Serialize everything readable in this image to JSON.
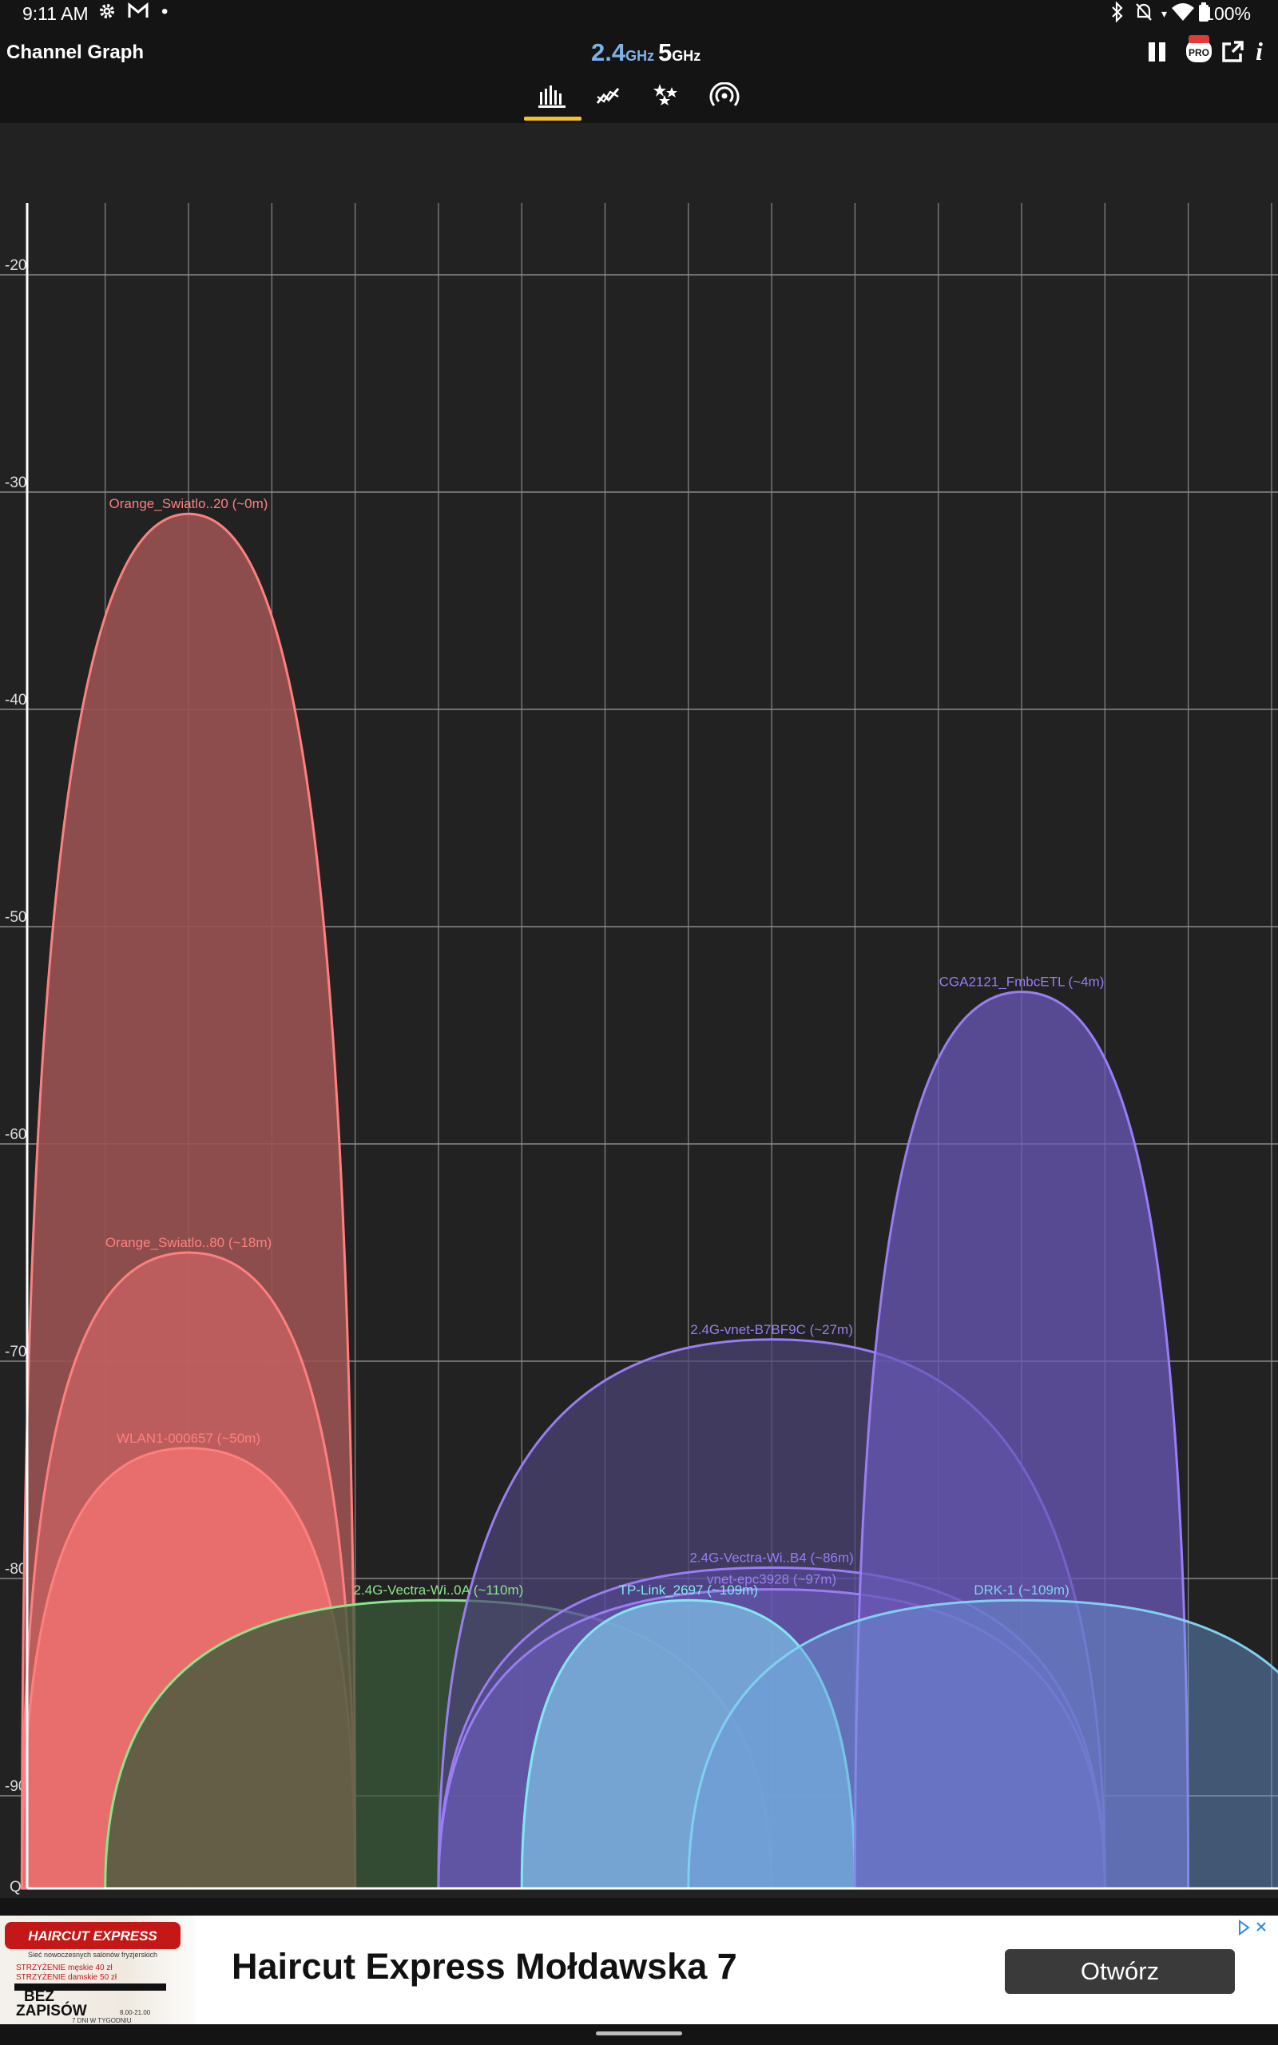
{
  "status_bar": {
    "time": "9:11 AM",
    "left_icons": [
      "gear-icon",
      "gmail-icon",
      "dot-icon"
    ],
    "right_icons": [
      "bluetooth-icon",
      "mute-icon",
      "wifi-icon",
      "battery-icon"
    ],
    "battery": "100%"
  },
  "app_bar": {
    "title": "Channel Graph",
    "band_24": {
      "num": "2.4",
      "unit": "GHz"
    },
    "band_5": {
      "num": "5",
      "unit": "GHz"
    },
    "actions": [
      "pause-icon",
      "pro-badge-icon",
      "export-icon",
      "info-icon"
    ],
    "tabs": [
      {
        "name": "channel-graph",
        "icon": "bar-chart-icon",
        "selected": true
      },
      {
        "name": "time-graph",
        "icon": "line-chart-icon",
        "selected": false
      },
      {
        "name": "channel-rating",
        "icon": "stars-icon",
        "selected": false
      },
      {
        "name": "access-points",
        "icon": "signal-icon",
        "selected": false
      }
    ],
    "accent_color": "#f6c02a"
  },
  "chart_data": {
    "type": "area",
    "ylabel": "",
    "xlabel": "",
    "ylim": [
      -100,
      -20
    ],
    "y_ticks": [
      "-20",
      "-30",
      "-40",
      "-50",
      "-60",
      "-70",
      "-80",
      "-90",
      "Q"
    ],
    "grid": true,
    "x_range": [
      -1,
      15
    ],
    "series": [
      {
        "name": "Orange_Swiatlo..20 (~0m)",
        "channel": 1,
        "width": 4,
        "peak": -31,
        "color": "#ff7f7f",
        "fill": "#9a5252",
        "fill_opacity": 0.9
      },
      {
        "name": "Orange_Swiatlo..80 (~18m)",
        "channel": 1,
        "width": 4,
        "peak": -65,
        "color": "#ff7f7f",
        "fill": "#c86262",
        "fill_opacity": 0.8
      },
      {
        "name": "WLAN1-000657 (~50m)",
        "channel": 1,
        "width": 4,
        "peak": -74,
        "color": "#ff7f7f",
        "fill": "#f07070",
        "fill_opacity": 0.85
      },
      {
        "name": "2.4G-Vectra-Wi..0A (~110m)",
        "channel": 4,
        "width": 8,
        "peak": -81,
        "color": "#8ae68a",
        "fill": "#3a5a3a",
        "fill_opacity": 0.75
      },
      {
        "name": "2.4G-vnet-B7BF9C (~27m)",
        "channel": 8,
        "width": 8,
        "peak": -69,
        "color": "#9a7cf5",
        "fill": "#4c4478",
        "fill_opacity": 0.7
      },
      {
        "name": "2.4G-Vectra-Wi..B4 (~86m)",
        "channel": 8,
        "width": 8,
        "peak": -79.5,
        "color": "#9a7cf5",
        "fill": "#6a58c8",
        "fill_opacity": 0.35
      },
      {
        "name": "vnet-epc3928 (~97m)",
        "channel": 8,
        "width": 8,
        "peak": -80.5,
        "color": "#9a7cf5",
        "fill": "#7a66d8",
        "fill_opacity": 0.35
      },
      {
        "name": "TP-Link_2697 (~109m)",
        "channel": 7,
        "width": 4,
        "peak": -81,
        "color": "#7fe8f0",
        "fill": "#7ab8e0",
        "fill_opacity": 0.8
      },
      {
        "name": "CGA2121_FmbcETL (~4m)",
        "channel": 11,
        "width": 4,
        "peak": -53,
        "color": "#9a7cf5",
        "fill": "#6a58b8",
        "fill_opacity": 0.75
      },
      {
        "name": "DRK-1 (~109m)",
        "channel": 11,
        "width": 8,
        "peak": -81,
        "color": "#7fd0f0",
        "fill": "#6a9ad8",
        "fill_opacity": 0.45
      }
    ]
  },
  "ad": {
    "title": "Haircut Express Mołdawska 7",
    "button": "Otwórz",
    "choices_icon": "adchoices-icon",
    "image_logo": "HAIRCUT EXPRESS",
    "image_sub": "Sieć nowoczesnych salonów fryzjerskich",
    "image_lines": [
      "STRZYŻENIE męskie 40 zł",
      "STRZYŻENIE damskie 50 zł",
      "BEZ",
      "ZAPISÓW",
      "8.00-21.00",
      "7 DNI W TYGODNIU"
    ]
  }
}
